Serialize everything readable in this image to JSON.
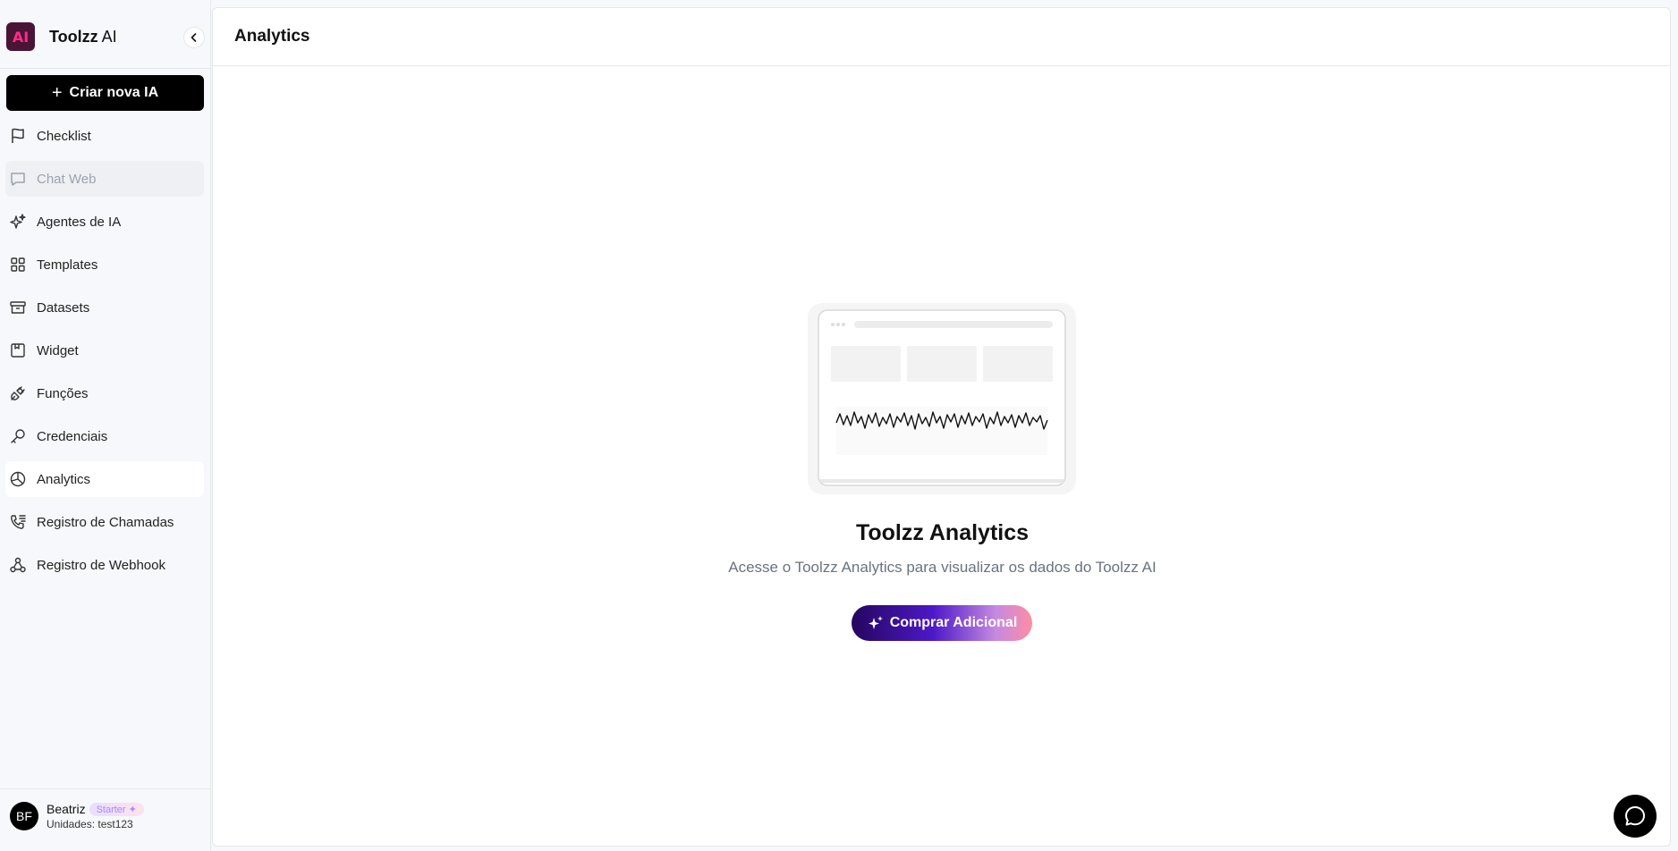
{
  "brand": {
    "logo_text": "AI",
    "name_bold": "Toolzz",
    "name_light": " AI"
  },
  "sidebar": {
    "create_label": "Criar nova IA",
    "items": [
      {
        "label": "Checklist",
        "icon": "flag-icon"
      },
      {
        "label": "Chat Web",
        "icon": "chat-icon",
        "state": "disabled"
      },
      {
        "label": "Agentes de IA",
        "icon": "sparkles-icon"
      },
      {
        "label": "Templates",
        "icon": "grid-icon"
      },
      {
        "label": "Datasets",
        "icon": "archive-icon"
      },
      {
        "label": "Widget",
        "icon": "widget-icon"
      },
      {
        "label": "Funções",
        "icon": "plug-icon"
      },
      {
        "label": "Credenciais",
        "icon": "key-icon"
      },
      {
        "label": "Analytics",
        "icon": "pie-chart-icon",
        "state": "active"
      },
      {
        "label": "Registro de Chamadas",
        "icon": "phone-list-icon"
      },
      {
        "label": "Registro de Webhook",
        "icon": "webhook-icon"
      }
    ]
  },
  "user": {
    "initials": "BF",
    "name": "Beatriz",
    "plan": "Starter",
    "units": "Unidades: test123"
  },
  "header": {
    "title": "Analytics"
  },
  "empty_state": {
    "title": "Toolzz Analytics",
    "subtitle": "Acesse o Toolzz Analytics para visualizar os dados do Toolzz AI",
    "button_label": "Comprar Adicional"
  },
  "colors": {
    "brand_logo_bg": "#4a1436",
    "brand_logo_fg": "#ff2d88",
    "primary_button": "#000000",
    "cta_gradient_start": "#25065e",
    "cta_gradient_end": "#ff8ca3"
  }
}
